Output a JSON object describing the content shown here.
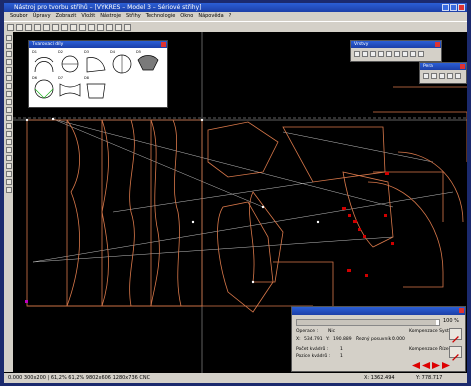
{
  "window": {
    "title": "Nástroj pro tvorbu střihů – [VÝKRES – Model 3 – Sériové střihy]"
  },
  "menu": [
    "Soubor",
    "Úpravy",
    "Zobrazit",
    "Vložit",
    "Nástroje",
    "Střihy",
    "Technologie",
    "Okno",
    "Nápověda",
    "?"
  ],
  "toolbar_icons": [
    "new-icon",
    "open-icon",
    "save-icon",
    "print-icon",
    "cut-icon",
    "copy-icon",
    "paste-icon",
    "undo-icon",
    "redo-icon",
    "zoom-icon",
    "pan-icon",
    "grid-icon",
    "measure-icon",
    "help-icon"
  ],
  "shapes_panel": {
    "title": "Tvarovací díly",
    "shapes": [
      "D1",
      "D2",
      "D3",
      "D4",
      "D5",
      "D6",
      "D7",
      "D8"
    ]
  },
  "mini_panel_1": {
    "title": "Vrstvy"
  },
  "mini_panel_2": {
    "title": "Pera"
  },
  "operation_panel": {
    "title": "",
    "zoom_pct": "100 %",
    "operation_label": "Operace :",
    "operation_value": "Nic",
    "x_label": "X:",
    "x_value": "534.791",
    "y_label": "Y:",
    "y_value": "190.889",
    "step_label": "Řezný posuvník :",
    "step_value": "0.000",
    "count1_label": "Počet kvádrů :",
    "count1_value": "1",
    "count2_label": "Pozice kvádrů :",
    "count2_value": "1",
    "comp_label": "Kompenzace Systém :",
    "comp2_label": "Kompenzace Řízení :",
    "slider_fraction": 0.98
  },
  "status": {
    "left": "0.000  300x200 | 61,2%  61,2%  9802x606 1280x736  CNC",
    "x": "X: 1362.494",
    "y": "Y: 778.717"
  },
  "colors": {
    "outline": "#d9784a",
    "accent": "#d00000",
    "guides": "#cfcfcf"
  }
}
